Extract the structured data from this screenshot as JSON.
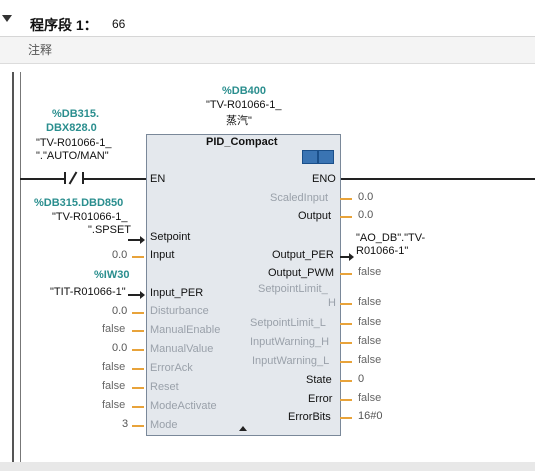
{
  "network": {
    "title": "程序段 1：",
    "number": "66",
    "comment": "注释"
  },
  "block": {
    "instance_db": "%DB400",
    "instance_name_l1": "\"TV-R01066-1_",
    "instance_name_l2": "蒸汽\"",
    "type": "PID_Compact",
    "en_label": "EN",
    "eno_label": "ENO"
  },
  "contact": {
    "address_l1": "%DB315.",
    "address_l2": "DBX828.0",
    "tag_l1": "\"TV-R01066-1_",
    "tag_l2": "\".\"AUTO/MAN\""
  },
  "setpoint_source": {
    "address": "%DB315.DBD850",
    "tag_l1": "\"TV-R01066-1_",
    "tag_l2": "\".SPSET"
  },
  "input_per_source": {
    "address": "%IW30",
    "tag": "\"TIT-R01066-1\""
  },
  "output_per_target": {
    "tag_l1": "\"AO_DB\".\"TV-",
    "tag_l2": "R01066-1\""
  },
  "inputs": [
    {
      "label": "Setpoint",
      "value": ""
    },
    {
      "label": "Input",
      "value": "0.0"
    },
    {
      "label": "Input_PER",
      "value": ""
    },
    {
      "label": "Disturbance",
      "value": "0.0"
    },
    {
      "label": "ManualEnable",
      "value": "false"
    },
    {
      "label": "ManualValue",
      "value": "0.0"
    },
    {
      "label": "ErrorAck",
      "value": "false"
    },
    {
      "label": "Reset",
      "value": "false"
    },
    {
      "label": "ModeActivate",
      "value": "false"
    },
    {
      "label": "Mode",
      "value": "3"
    }
  ],
  "outputs": [
    {
      "label": "ScaledInput",
      "value": "0.0"
    },
    {
      "label": "Output",
      "value": "0.0"
    },
    {
      "label": "Output_PER",
      "value": ""
    },
    {
      "label": "Output_PWM",
      "value": "false"
    },
    {
      "label_l1": "SetpointLimit_",
      "label_l2": "H",
      "value": "false"
    },
    {
      "label": "SetpointLimit_L",
      "value": "false"
    },
    {
      "label": "InputWarning_H",
      "value": "false"
    },
    {
      "label": "InputWarning_L",
      "value": "false"
    },
    {
      "label": "State",
      "value": "0"
    },
    {
      "label": "Error",
      "value": "false"
    },
    {
      "label": "ErrorBits",
      "value": "16#0"
    }
  ]
}
